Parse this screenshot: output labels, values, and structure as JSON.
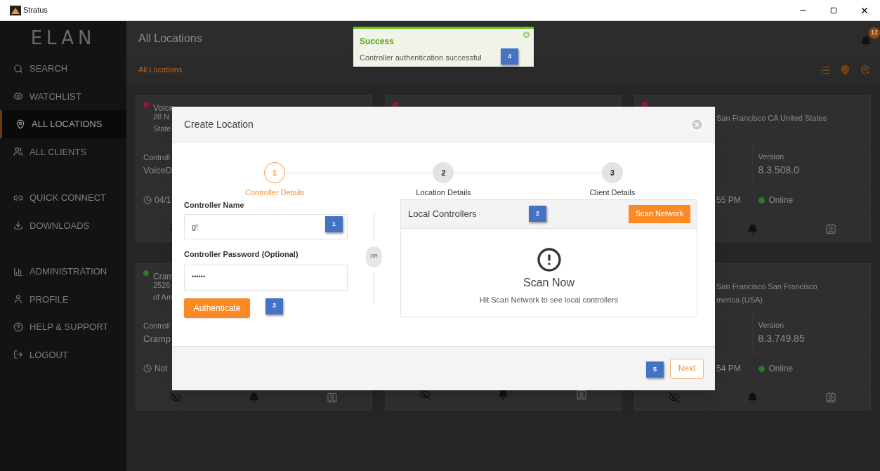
{
  "window": {
    "title": "Stratus"
  },
  "sidebar": {
    "logo": "ELAN",
    "groups": [
      {
        "items": [
          {
            "label": "SEARCH",
            "selected": false
          },
          {
            "label": "WATCHLIST",
            "selected": false
          },
          {
            "label": "ALL LOCATIONS",
            "selected": true
          },
          {
            "label": "ALL CLIENTS",
            "selected": false
          }
        ]
      },
      {
        "items": [
          {
            "label": "QUICK CONNECT",
            "selected": false
          },
          {
            "label": "DOWNLOADS",
            "selected": false
          }
        ]
      },
      {
        "items": [
          {
            "label": "ADMINISTRATION",
            "selected": false
          },
          {
            "label": "PROFILE",
            "selected": false
          },
          {
            "label": "HELP & SUPPORT",
            "selected": false
          },
          {
            "label": "LOGOUT",
            "selected": false
          }
        ]
      }
    ]
  },
  "header": {
    "title": "All Locations",
    "notification_count": "12"
  },
  "breadcrumb": "All Locations",
  "cards": [
    {
      "color": "#8e1a30",
      "name": "Voice",
      "address": [
        "28 N",
        "State"
      ],
      "controller_label": "Controll",
      "controller_value": "VoiceD",
      "time": "04/1"
    },
    {
      "color": "#8e1a30"
    },
    {
      "color": "#8e1a30",
      "address": [
        "San Francisco CA United States"
      ],
      "version_label": "Version",
      "version_value": "8.3.508.0",
      "time": "55 PM",
      "status": {
        "label": "Online",
        "color": "#2a7a2a"
      }
    },
    {
      "color": "#2a7a2a",
      "name": "Cram",
      "address": [
        "2526",
        "of Am"
      ],
      "controller_label": "Controll",
      "controller_value": "Cramp",
      "time": "Not"
    },
    {
      "kind": "covered"
    },
    {
      "address": [
        "San Francisco San Francisco",
        "merica (USA)"
      ],
      "version_label": "Version",
      "version_value": "8.3.749.85",
      "time": "54 PM",
      "status": {
        "label": "Online",
        "color": "#2a7a2a"
      }
    }
  ],
  "toast": {
    "title": "Success",
    "message": "Controller authentication successful",
    "callout": "4"
  },
  "dialog": {
    "title": "Create Location",
    "steps": [
      {
        "number": "1",
        "label": "Controller Details",
        "selected": true
      },
      {
        "number": "2",
        "label": "Location Details",
        "selected": false
      },
      {
        "number": "3",
        "label": "Client Details",
        "selected": false
      }
    ],
    "controller_name": {
      "label": "Controller Name",
      "value": "g!",
      "callout": "1"
    },
    "controller_password": {
      "label": "Controller Password (Optional)",
      "value": "••••••"
    },
    "authenticate": {
      "label": "Authenticate",
      "callout": "3"
    },
    "separator": "OR",
    "local_controllers": {
      "title": "Local Controllers",
      "callout": "2",
      "scan_button": "Scan Network",
      "empty_title": "Scan Now",
      "empty_message": "Hit Scan Network to see local controllers"
    },
    "footer": {
      "callout": "5",
      "next": "Next"
    }
  }
}
